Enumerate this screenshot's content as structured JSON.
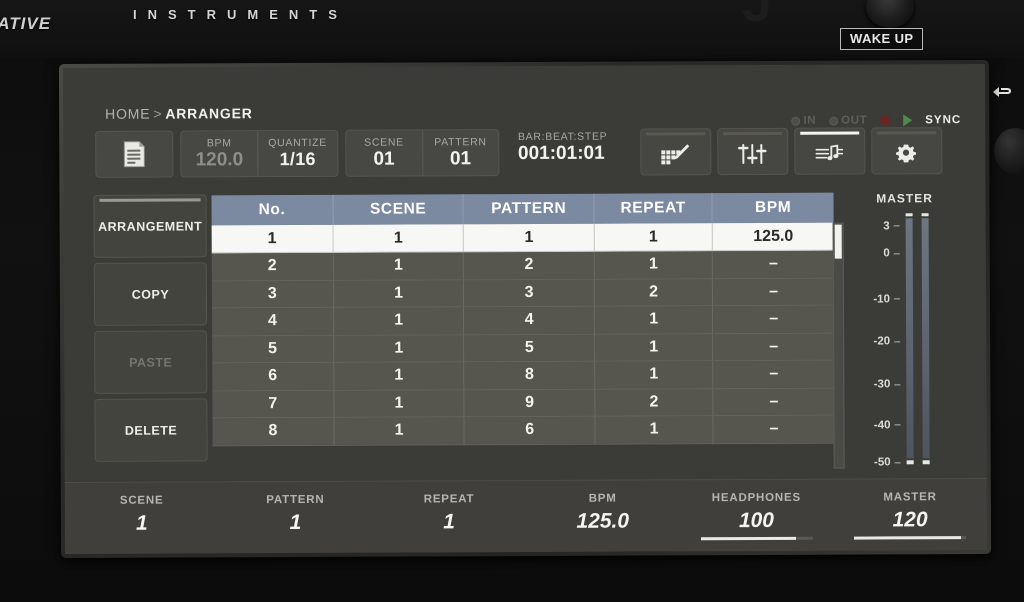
{
  "device": {
    "brand_left": "NATIVE",
    "brand_right": "INSTRUMENTS",
    "wake_up_label": "WAKE UP"
  },
  "breadcrumb": {
    "root": "HOME",
    "separator": ">",
    "current": "ARRANGER"
  },
  "transport": {
    "midi_in_label": "IN",
    "midi_out_label": "OUT",
    "sync_label": "SYNC"
  },
  "toolbar": {
    "doc_icon": "document-icon",
    "fields": [
      {
        "label": "BPM",
        "value": "120.0",
        "dim": true
      },
      {
        "label": "QUANTIZE",
        "value": "1/16",
        "dim": false
      },
      {
        "label": "SCENE",
        "value": "01",
        "dim": false
      },
      {
        "label": "PATTERN",
        "value": "01",
        "dim": false
      }
    ],
    "bar_beat_step": {
      "label": "BAR:BEAT:STEP",
      "value": "001:01:01"
    },
    "icon_buttons": [
      {
        "name": "pattern-edit-icon",
        "active": false
      },
      {
        "name": "mixer-faders-icon",
        "active": false
      },
      {
        "name": "arranger-notes-icon",
        "active": true
      },
      {
        "name": "settings-gear-icon",
        "active": true
      }
    ]
  },
  "sidebar": {
    "items": [
      {
        "label": "ARRANGEMENT",
        "active": true,
        "disabled": false
      },
      {
        "label": "COPY",
        "active": false,
        "disabled": false
      },
      {
        "label": "PASTE",
        "active": false,
        "disabled": true
      },
      {
        "label": "DELETE",
        "active": false,
        "disabled": false
      }
    ]
  },
  "table": {
    "columns": [
      "No.",
      "SCENE",
      "PATTERN",
      "REPEAT",
      "BPM"
    ],
    "rows": [
      {
        "no": "1",
        "scene": "1",
        "pattern": "1",
        "repeat": "1",
        "bpm": "125.0",
        "selected": true
      },
      {
        "no": "2",
        "scene": "1",
        "pattern": "2",
        "repeat": "1",
        "bpm": "–",
        "selected": false
      },
      {
        "no": "3",
        "scene": "1",
        "pattern": "3",
        "repeat": "2",
        "bpm": "–",
        "selected": false
      },
      {
        "no": "4",
        "scene": "1",
        "pattern": "4",
        "repeat": "1",
        "bpm": "–",
        "selected": false
      },
      {
        "no": "5",
        "scene": "1",
        "pattern": "5",
        "repeat": "1",
        "bpm": "–",
        "selected": false
      },
      {
        "no": "6",
        "scene": "1",
        "pattern": "8",
        "repeat": "1",
        "bpm": "–",
        "selected": false
      },
      {
        "no": "7",
        "scene": "1",
        "pattern": "9",
        "repeat": "2",
        "bpm": "–",
        "selected": false
      },
      {
        "no": "8",
        "scene": "1",
        "pattern": "6",
        "repeat": "1",
        "bpm": "–",
        "selected": false
      }
    ]
  },
  "master_meter": {
    "title": "MASTER",
    "ticks": [
      "3",
      "0",
      "-10",
      "-20",
      "-30",
      "-40",
      "-50"
    ],
    "tick_positions_pct": [
      3,
      14,
      32,
      49,
      66,
      82,
      97
    ],
    "channels": 2
  },
  "status_bar": {
    "cells": [
      {
        "label": "SCENE",
        "value": "1",
        "slider": null
      },
      {
        "label": "PATTERN",
        "value": "1",
        "slider": null
      },
      {
        "label": "REPEAT",
        "value": "1",
        "slider": null
      },
      {
        "label": "BPM",
        "value": "125.0",
        "slider": null
      },
      {
        "label": "HEADPHONES",
        "value": "100",
        "slider": 85
      },
      {
        "label": "MASTER",
        "value": "120",
        "slider": 95
      }
    ]
  },
  "colors": {
    "header_blue": "#7b8aa0",
    "screen_bg": "#3b3b38",
    "panel": "#474743",
    "text_bright": "#f2f2ee",
    "text_dim": "#8e8e88",
    "accent_white": "#ffffff"
  }
}
